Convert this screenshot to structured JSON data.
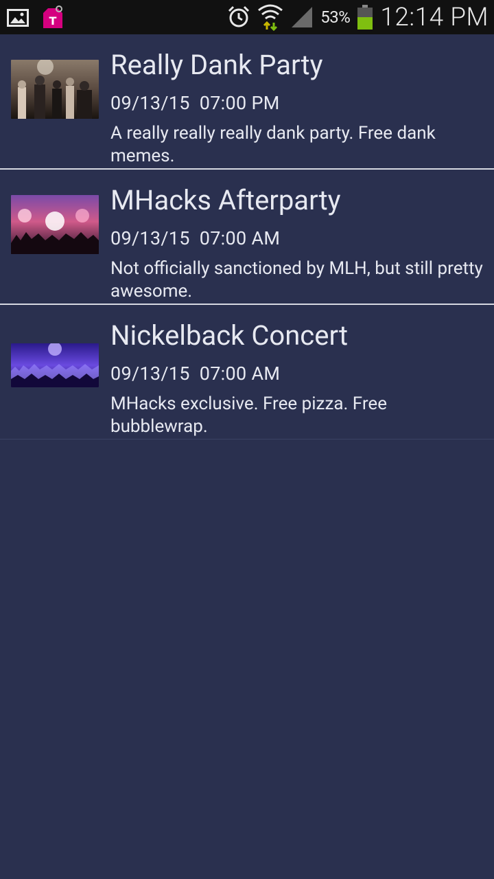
{
  "status_bar": {
    "battery_percent": "53%",
    "time": "12:14 PM",
    "icons": [
      "image-icon",
      "t-mobile-icon",
      "alarm-icon",
      "wifi-data-icon",
      "cell-signal-icon",
      "battery-icon"
    ]
  },
  "events": [
    {
      "title": "Really Dank Party",
      "date": "09/13/15",
      "time": "07:00 PM",
      "description": "A really really really dank party. Free dank memes."
    },
    {
      "title": "MHacks Afterparty",
      "date": "09/13/15",
      "time": "07:00 AM",
      "description": "Not officially sanctioned by MLH, but still pretty awesome."
    },
    {
      "title": "Nickelback Concert",
      "date": "09/13/15",
      "time": "07:00 AM",
      "description": "MHacks exclusive. Free pizza. Free bubblewrap."
    }
  ],
  "colors": {
    "background": "#2a304f",
    "status_bar": "#111111",
    "text": "#e7e9f1",
    "divider": "#d7d9e2",
    "battery_fill": "#7fbf10"
  }
}
